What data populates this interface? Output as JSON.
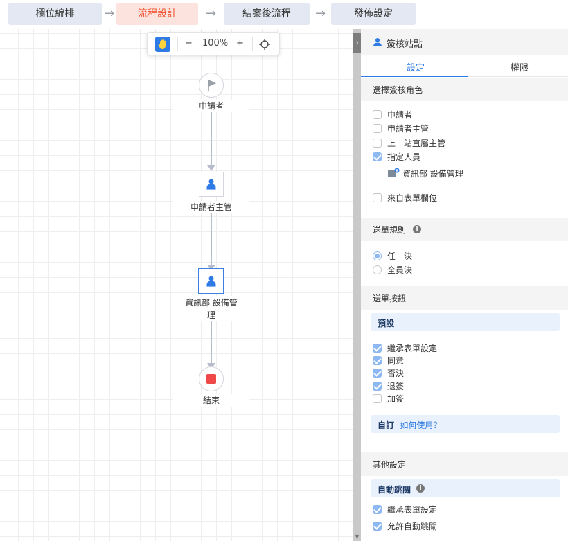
{
  "steps": [
    {
      "label": "欄位編排",
      "active": false
    },
    {
      "label": "流程設計",
      "active": true
    },
    {
      "label": "結案後流程",
      "active": false
    },
    {
      "label": "發佈設定",
      "active": false
    }
  ],
  "step_arrow": "→",
  "toolbar": {
    "zoom_out": "−",
    "zoom_level": "100%",
    "zoom_in": "+"
  },
  "nodes": {
    "start": {
      "label": "申請者"
    },
    "manager": {
      "label": "申請者主管"
    },
    "dept": {
      "label": "資訊部 設備管理"
    },
    "end": {
      "label": "結束"
    }
  },
  "panel": {
    "title": "簽核站點",
    "tabs": [
      "設定",
      "權限"
    ],
    "roles": {
      "heading": "選擇簽核角色",
      "options": [
        {
          "label": "申請者",
          "checked": false
        },
        {
          "label": "申請者主管",
          "checked": false
        },
        {
          "label": "上一站直屬主管",
          "checked": false
        },
        {
          "label": "指定人員",
          "checked": true
        }
      ],
      "assigned": "資訊部 設備管理",
      "form_field": {
        "label": "來自表單欄位",
        "checked": false
      }
    },
    "send_rule": {
      "heading": "送單規則",
      "options": [
        {
          "label": "任一決",
          "selected": true
        },
        {
          "label": "全員決",
          "selected": false
        }
      ]
    },
    "buttons": {
      "heading": "送單按鈕",
      "preset_label": "預設",
      "options": [
        {
          "label": "繼承表單設定",
          "checked": true
        },
        {
          "label": "同意",
          "checked": true
        },
        {
          "label": "否決",
          "checked": true
        },
        {
          "label": "退簽",
          "checked": true
        },
        {
          "label": "加簽",
          "checked": false
        }
      ],
      "custom_label": "自訂",
      "custom_link": "如何使用？"
    },
    "other": {
      "heading": "其他設定",
      "auto_jump_label": "自動跳關",
      "options": [
        {
          "label": "繼承表單設定",
          "checked": true
        },
        {
          "label": "允許自動跳關",
          "checked": true
        }
      ]
    }
  },
  "colors": {
    "accent": "#2f7be6",
    "active_step_bg": "#fde3de",
    "active_step_text": "#f25533",
    "end_node": "#f04848"
  }
}
